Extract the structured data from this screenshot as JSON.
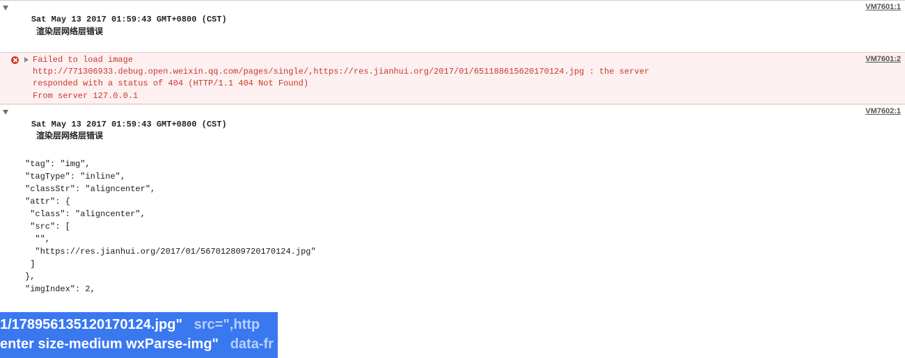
{
  "rows": [
    {
      "timestamp": "Sat May 13 2017 01:59:43 GMT+0800 (CST)",
      "title": "渲染层网络层错误",
      "source": "VM7601:1"
    },
    {
      "error_header": "Failed to load image",
      "error_line1": "http://771306933.debug.open.weixin.qq.com/pages/single/,https://res.jianhui.org/2017/01/651188615620170124.jpg : the server",
      "error_line2": "responded with a status of 404 (HTTP/1.1 404 Not Found)",
      "error_line3": "From server 127.0.0.1",
      "source": "VM7601:2"
    },
    {
      "timestamp": "Sat May 13 2017 01:59:43 GMT+0800 (CST)",
      "title": "渲染层网络层错误",
      "source": "VM7602:1"
    }
  ],
  "json_block": "\"tag\": \"img\",\n\"tagType\": \"inline\",\n\"classStr\": \"aligncenter\",\n\"attr\": {\n \"class\": \"aligncenter\",\n \"src\": [\n  \"\",\n  \"https://res.jianhui.org/2017/01/567012809720170124.jpg\"\n ]\n},\n\"imgIndex\": 2,",
  "highlight": {
    "seg1": "1/178956135120170124.jpg\"",
    "seg2": "src=\",http",
    "seg3": "enter size-medium wxParse-img\"",
    "seg4": "data-fr"
  }
}
